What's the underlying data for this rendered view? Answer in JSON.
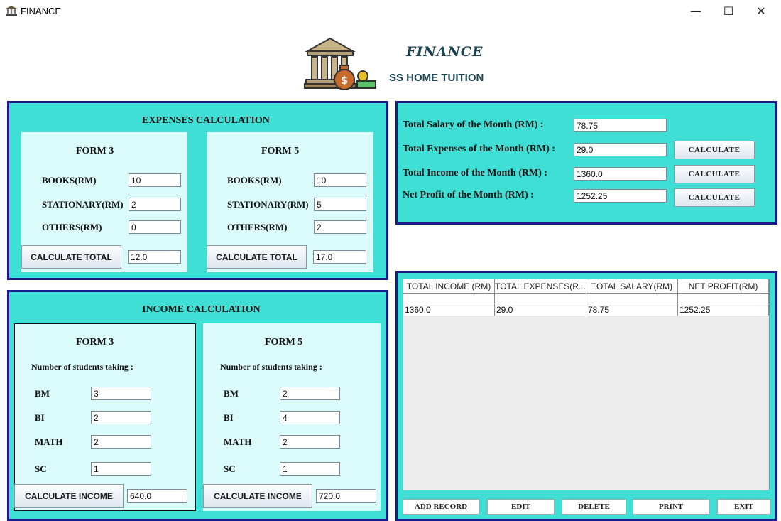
{
  "window": {
    "title": "FINANCE",
    "minimize": "—",
    "maximize": "☐",
    "close": "✕"
  },
  "header": {
    "title": "FINANCE",
    "subtitle": "SS HOME TUITION",
    "logo_icon": "bank-money-icon"
  },
  "expenses": {
    "title": "EXPENSES CALCULATION",
    "form3": {
      "title": "FORM 3",
      "books_label": "BOOKS(RM)",
      "books_value": "10",
      "stationary_label": "STATIONARY(RM)",
      "stationary_value": "2",
      "others_label": "OTHERS(RM)",
      "others_value": "0",
      "button": "CALCULATE TOTAL",
      "total": "12.0"
    },
    "form5": {
      "title": "FORM 5",
      "books_label": "BOOKS(RM)",
      "books_value": "10",
      "stationary_label": "STATIONARY(RM)",
      "stationary_value": "5",
      "others_label": "OTHERS(RM)",
      "others_value": "2",
      "button": "CALCULATE TOTAL",
      "total": "17.0"
    }
  },
  "income": {
    "title": "INCOME CALCULATION",
    "form3": {
      "title": "FORM 3",
      "subtitle": "Number of students taking :",
      "bm_label": "BM",
      "bm_value": "3",
      "bi_label": "BI",
      "bi_value": "2",
      "math_label": "MATH",
      "math_value": "2",
      "sc_label": "SC",
      "sc_value": "1",
      "button": "CALCULATE INCOME",
      "total": "640.0"
    },
    "form5": {
      "title": "FORM 5",
      "subtitle": "Number of students taking :",
      "bm_label": "BM",
      "bm_value": "2",
      "bi_label": "BI",
      "bi_value": "4",
      "math_label": "MATH",
      "math_value": "2",
      "sc_label": "SC",
      "sc_value": "1",
      "button": "CALCULATE INCOME",
      "total": "720.0"
    }
  },
  "summary": {
    "salary_label": "Total Salary of the Month (RM) :",
    "salary_value": "78.75",
    "expenses_label": "Total Expenses of the Month (RM)  :",
    "expenses_value": "29.0",
    "income_label": "Total Income of the Month (RM) :",
    "income_value": "1360.0",
    "profit_label": "Net Profit of the Month (RM) :",
    "profit_value": "1252.25",
    "calc_button": "CALCULATE"
  },
  "table": {
    "columns": [
      "TOTAL INCOME (RM)",
      "TOTAL EXPENSES(R...",
      "TOTAL SALARY(RM)",
      "NET PROFIT(RM)"
    ],
    "rows": [
      [
        "1360.0",
        "29.0",
        "78.75",
        "1252.25"
      ]
    ]
  },
  "actions": {
    "add": "ADD RECORD",
    "edit": "EDIT",
    "delete": "DELETE",
    "print": "PRINT",
    "exit": "EXIT"
  }
}
